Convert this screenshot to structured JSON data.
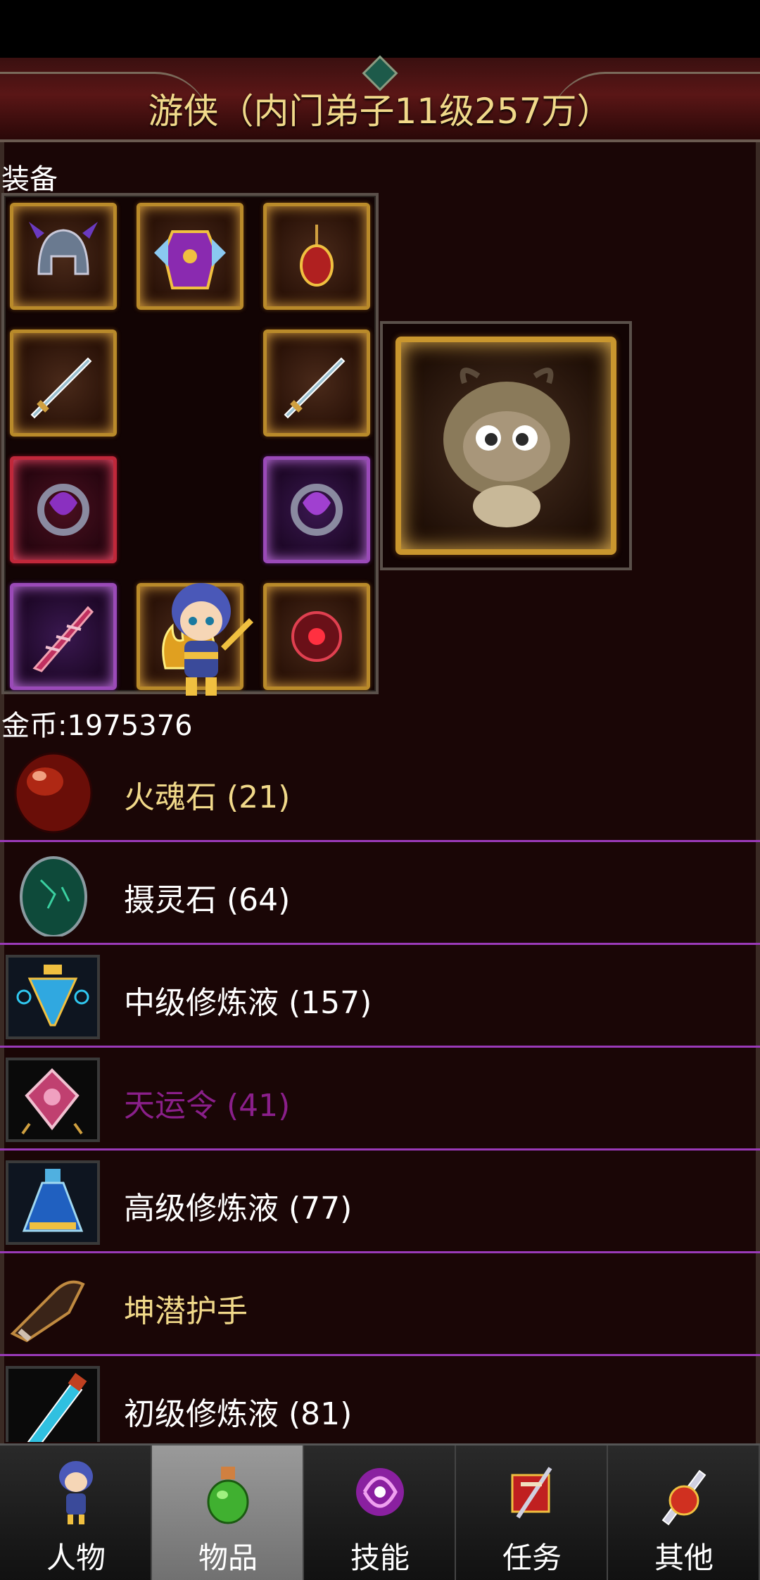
{
  "header": {
    "title": "游侠（内门弟子11级257万）"
  },
  "equipment": {
    "label": "装备",
    "slots": [
      {
        "name": "helmet-icon",
        "rarity": "gold"
      },
      {
        "name": "armor-icon",
        "rarity": "gold"
      },
      {
        "name": "amulet-icon",
        "rarity": "gold"
      },
      {
        "name": "sword-icon",
        "rarity": "gold"
      },
      {
        "name": "sword-icon",
        "rarity": "gold"
      },
      {
        "name": "ring-icon",
        "rarity": "red"
      },
      {
        "name": "ring-icon",
        "rarity": "purple"
      },
      {
        "name": "blade-icon",
        "rarity": "purple"
      },
      {
        "name": "flame-icon",
        "rarity": "gold"
      },
      {
        "name": "orb-icon",
        "rarity": "gold"
      }
    ]
  },
  "gold": {
    "text": "金币:1975376"
  },
  "items": [
    {
      "name": "火魂石 (21)",
      "color": "#f1d98a",
      "icon": "fire-stone-icon"
    },
    {
      "name": "摄灵石 (64)",
      "color": "#ffffff",
      "icon": "soul-stone-icon"
    },
    {
      "name": "中级修炼液 (157)",
      "color": "#ffffff",
      "icon": "potion-icon"
    },
    {
      "name": "天运令 (41)",
      "color": "#8a1f8a",
      "icon": "token-icon"
    },
    {
      "name": "高级修炼液 (77)",
      "color": "#ffffff",
      "icon": "potion-icon"
    },
    {
      "name": "坤潜护手",
      "color": "#f1d98a",
      "icon": "gauntlet-icon"
    },
    {
      "name": "初级修炼液 (81)",
      "color": "#ffffff",
      "icon": "vial-icon"
    }
  ],
  "tabs": [
    {
      "label": "人物",
      "icon": "character-icon",
      "active": false
    },
    {
      "label": "物品",
      "icon": "bag-icon",
      "active": true
    },
    {
      "label": "技能",
      "icon": "skill-icon",
      "active": false
    },
    {
      "label": "任务",
      "icon": "quest-icon",
      "active": false
    },
    {
      "label": "其他",
      "icon": "other-icon",
      "active": false
    }
  ],
  "colors": {
    "background": "#1a0606",
    "title": "#f1d98a",
    "divider": "#9a3ab8",
    "purple_text": "#8a1f8a"
  }
}
